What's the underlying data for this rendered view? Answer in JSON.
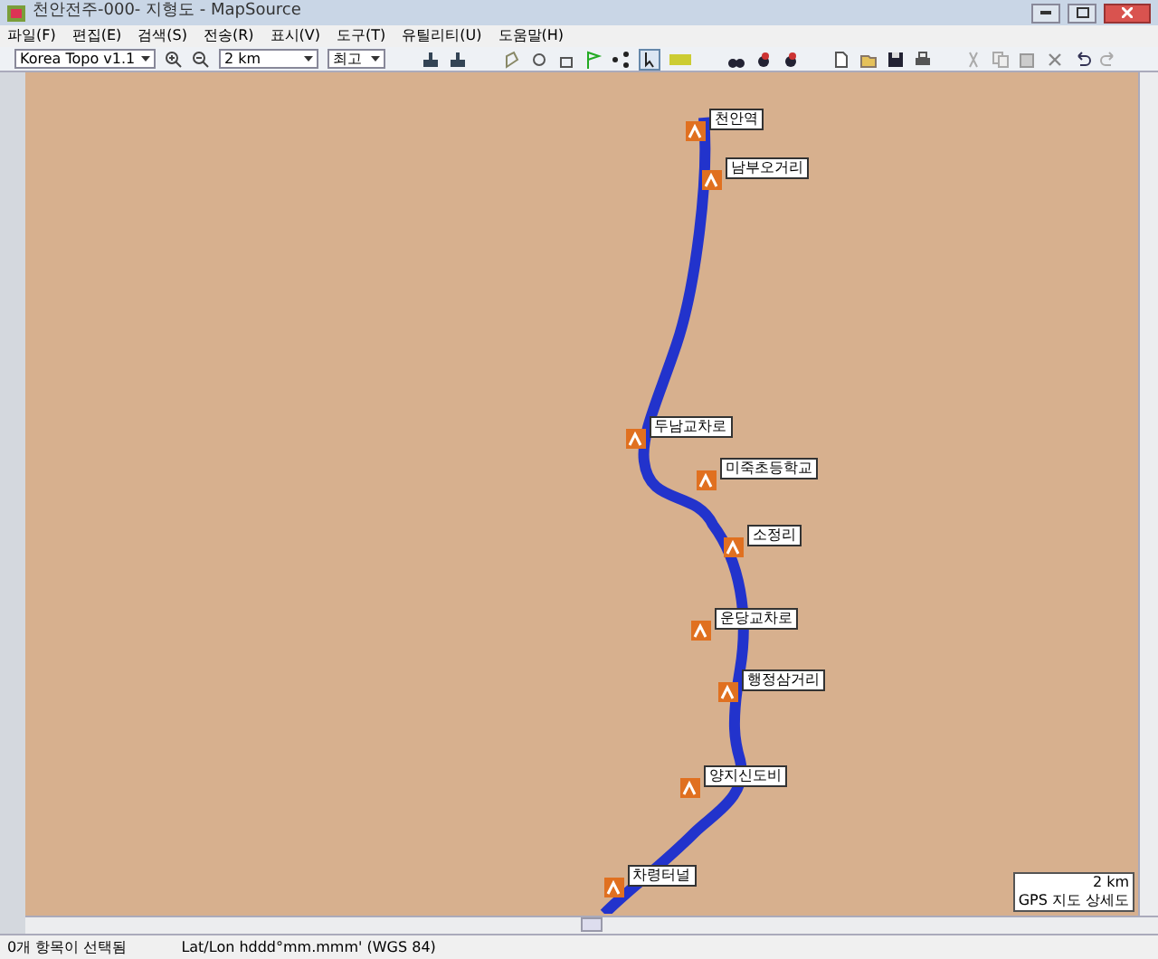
{
  "window": {
    "title": "천안전주-000- 지형도 - MapSource"
  },
  "menu": [
    "파일(F)",
    "편집(E)",
    "검색(S)",
    "전송(R)",
    "표시(V)",
    "도구(T)",
    "유틸리티(U)",
    "도움말(H)"
  ],
  "toolbar": {
    "map_product": "Korea Topo v1.1",
    "zoom": "2 km",
    "detail": "최고"
  },
  "waypoints": [
    {
      "label": "천안역"
    },
    {
      "label": "남부오거리"
    },
    {
      "label": "두남교차로"
    },
    {
      "label": "미죽초등학교"
    },
    {
      "label": "소정리"
    },
    {
      "label": "운당교차로"
    },
    {
      "label": "행정삼거리"
    },
    {
      "label": "양지신도비"
    },
    {
      "label": "차령터널"
    }
  ],
  "map_legend": {
    "scale": "2 km",
    "detail_label": "GPS 지도 상세도"
  },
  "status_bar": {
    "selection": "0개 항목이 선택됨",
    "coordinates": "Lat/Lon hddd°mm.mmm' (WGS 84)"
  }
}
